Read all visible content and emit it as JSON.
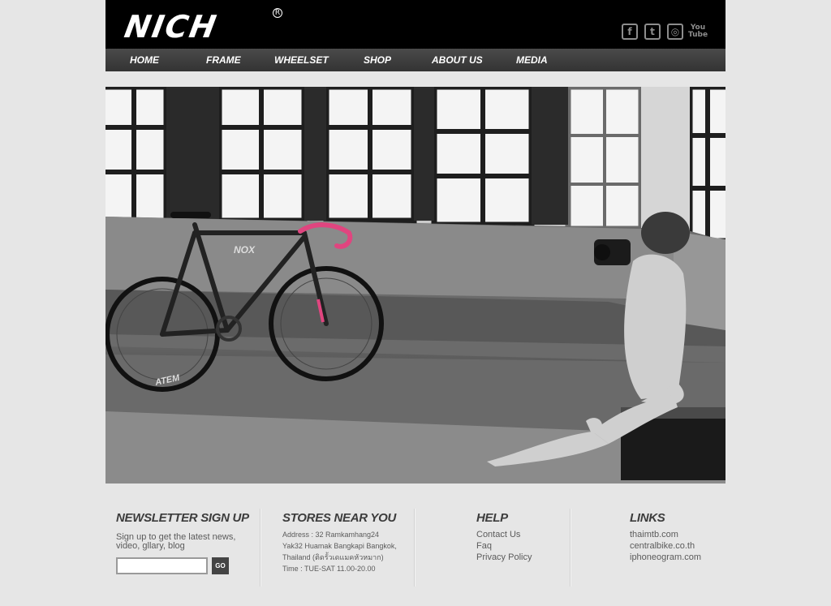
{
  "brand": {
    "logo_text": "NICH",
    "registered_mark": "R"
  },
  "social": [
    {
      "name": "facebook",
      "glyph": "f"
    },
    {
      "name": "twitter",
      "glyph": "t"
    },
    {
      "name": "instagram",
      "glyph": "◎"
    },
    {
      "name": "youtube",
      "glyph_top": "You",
      "glyph_bottom": "Tube"
    }
  ],
  "nav": {
    "items": [
      {
        "label": "HOME"
      },
      {
        "label": "FRAME"
      },
      {
        "label": "WHEELSET"
      },
      {
        "label": "SHOP"
      },
      {
        "label": "ABOUT US"
      },
      {
        "label": "MEDIA"
      }
    ]
  },
  "hero": {
    "frame_label": "NOX",
    "wheel_label": "ATEM",
    "accent_color": "#e0457f"
  },
  "newsletter": {
    "title": "NEWSLETTER SIGN UP",
    "text": "Sign up to get the latest news, video, gllary, blog",
    "input_value": "",
    "go_label": "GO"
  },
  "stores": {
    "title": "STORES NEAR YOU",
    "lines": [
      "Address : 32 Ramkamhang24",
      "Yak32 Huamak Bangkapi Bangkok,",
      "Thailand (ติดรั้วเดแมคหัวหมาก)",
      "Time : TUE-SAT 11.00-20.00"
    ]
  },
  "help": {
    "title": "HELP",
    "items": [
      "Contact Us",
      "Faq",
      "Privacy  Policy"
    ]
  },
  "links": {
    "title": "LINKS",
    "items": [
      "thaimtb.com",
      "centralbike.co.th",
      "iphoneogram.com"
    ]
  }
}
